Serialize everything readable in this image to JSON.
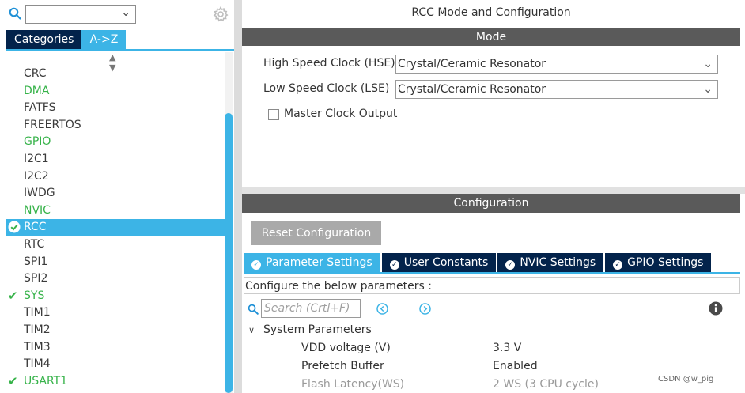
{
  "left_panel": {
    "search_value": "",
    "tabs": [
      {
        "label": "Categories"
      },
      {
        "label": "A->Z"
      }
    ],
    "peripherals": [
      {
        "label": "CRC",
        "state": "normal"
      },
      {
        "label": "DMA",
        "state": "green"
      },
      {
        "label": "FATFS",
        "state": "normal"
      },
      {
        "label": "FREERTOS",
        "state": "normal"
      },
      {
        "label": "GPIO",
        "state": "green"
      },
      {
        "label": "I2C1",
        "state": "normal"
      },
      {
        "label": "I2C2",
        "state": "normal"
      },
      {
        "label": "IWDG",
        "state": "normal"
      },
      {
        "label": "NVIC",
        "state": "green"
      },
      {
        "label": "RCC",
        "state": "selected"
      },
      {
        "label": "RTC",
        "state": "normal"
      },
      {
        "label": "SPI1",
        "state": "normal"
      },
      {
        "label": "SPI2",
        "state": "normal"
      },
      {
        "label": "SYS",
        "state": "checked"
      },
      {
        "label": "TIM1",
        "state": "normal"
      },
      {
        "label": "TIM2",
        "state": "normal"
      },
      {
        "label": "TIM3",
        "state": "normal"
      },
      {
        "label": "TIM4",
        "state": "normal"
      },
      {
        "label": "USART1",
        "state": "checked"
      }
    ]
  },
  "right_panel": {
    "title": "RCC Mode and Configuration",
    "mode": {
      "header": "Mode",
      "hse_label": "High Speed Clock (HSE)",
      "hse_value": "Crystal/Ceramic Resonator",
      "lse_label": "Low Speed Clock (LSE)",
      "lse_value": "Crystal/Ceramic Resonator",
      "mco_label": "Master Clock Output",
      "mco_checked": false
    },
    "configuration": {
      "header": "Configuration",
      "reset_label": "Reset Configuration",
      "tabs": [
        {
          "label": "Parameter Settings",
          "active": true
        },
        {
          "label": "User Constants",
          "active": false
        },
        {
          "label": "NVIC Settings",
          "active": false
        },
        {
          "label": "GPIO Settings",
          "active": false
        }
      ],
      "configure_text": "Configure the below parameters :",
      "search_placeholder": "Search (Crtl+F)",
      "group_label": "System Parameters",
      "params": [
        {
          "name": "VDD voltage (V)",
          "value": "3.3 V"
        },
        {
          "name": "Prefetch Buffer",
          "value": "Enabled"
        },
        {
          "name": "Flash Latency(WS)",
          "value": "2 WS (3 CPU cycle)"
        }
      ]
    }
  },
  "watermark": "CSDN @w_pig",
  "colors": {
    "accent": "#3cb4e6",
    "navy": "#03234b",
    "enabled_green": "#37b34a",
    "header_gray": "#5a5a5a"
  }
}
